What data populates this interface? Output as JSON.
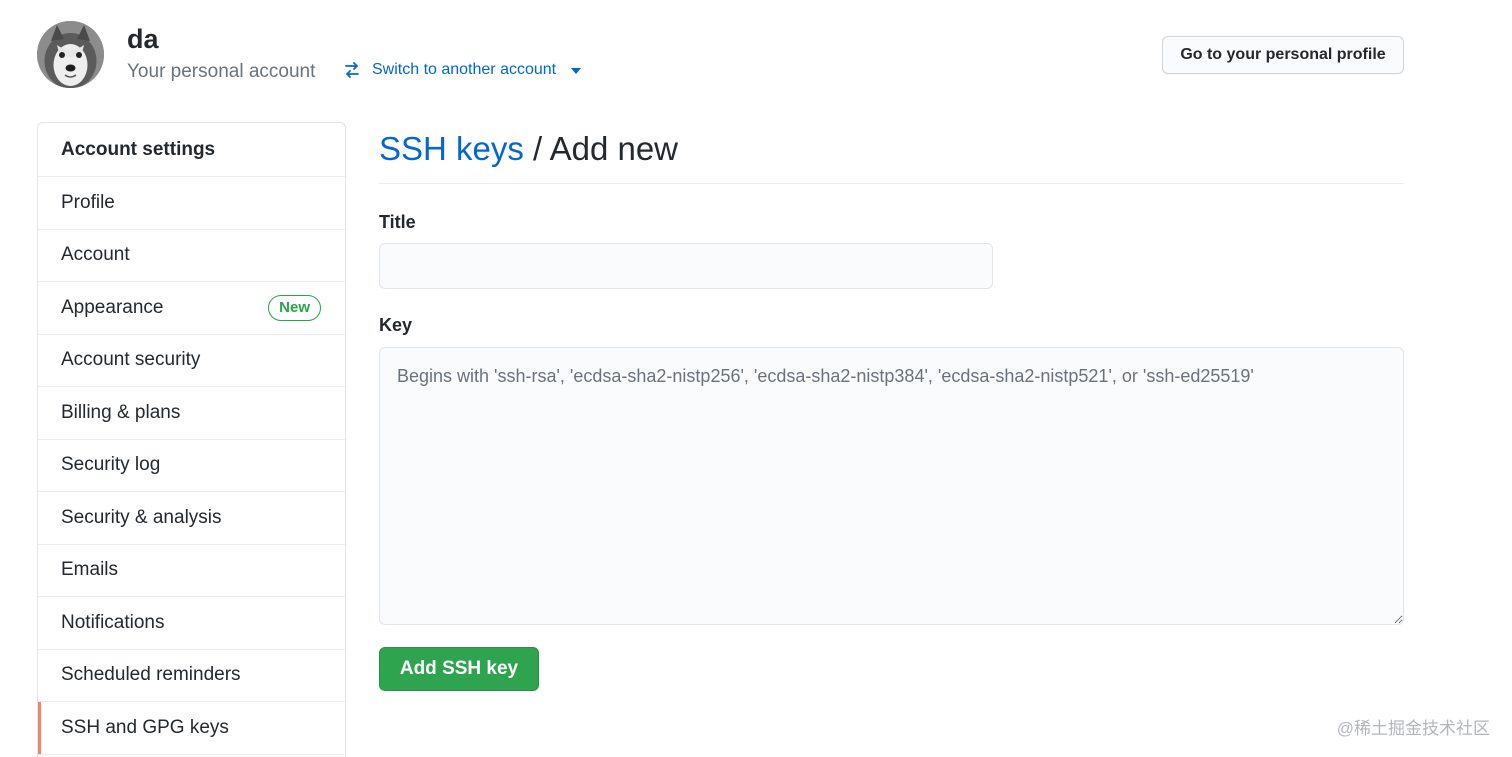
{
  "header": {
    "user_name": "da",
    "account_type": "Your personal account",
    "switch_account_label": "Switch to another account",
    "profile_button_label": "Go to your personal profile"
  },
  "sidebar": {
    "heading": "Account settings",
    "items": [
      {
        "label": "Profile",
        "selected": false
      },
      {
        "label": "Account",
        "selected": false
      },
      {
        "label": "Appearance",
        "selected": false,
        "badge": "New"
      },
      {
        "label": "Account security",
        "selected": false
      },
      {
        "label": "Billing & plans",
        "selected": false
      },
      {
        "label": "Security log",
        "selected": false
      },
      {
        "label": "Security & analysis",
        "selected": false
      },
      {
        "label": "Emails",
        "selected": false
      },
      {
        "label": "Notifications",
        "selected": false
      },
      {
        "label": "Scheduled reminders",
        "selected": false
      },
      {
        "label": "SSH and GPG keys",
        "selected": true
      }
    ]
  },
  "main": {
    "breadcrumb_link": "SSH keys",
    "breadcrumb_separator": "/",
    "breadcrumb_current": "Add new",
    "title_label": "Title",
    "title_value": "",
    "key_label": "Key",
    "key_value": "",
    "key_placeholder": "Begins with 'ssh-rsa', 'ecdsa-sha2-nistp256', 'ecdsa-sha2-nistp384', 'ecdsa-sha2-nistp521', or 'ssh-ed25519'",
    "submit_label": "Add SSH key"
  },
  "watermark": "@稀土掘金技术社区",
  "colors": {
    "link": "#0366d6",
    "primary_button": "#2ea44f",
    "badge_green": "#28a745",
    "selected_indicator": "#f9826c"
  }
}
